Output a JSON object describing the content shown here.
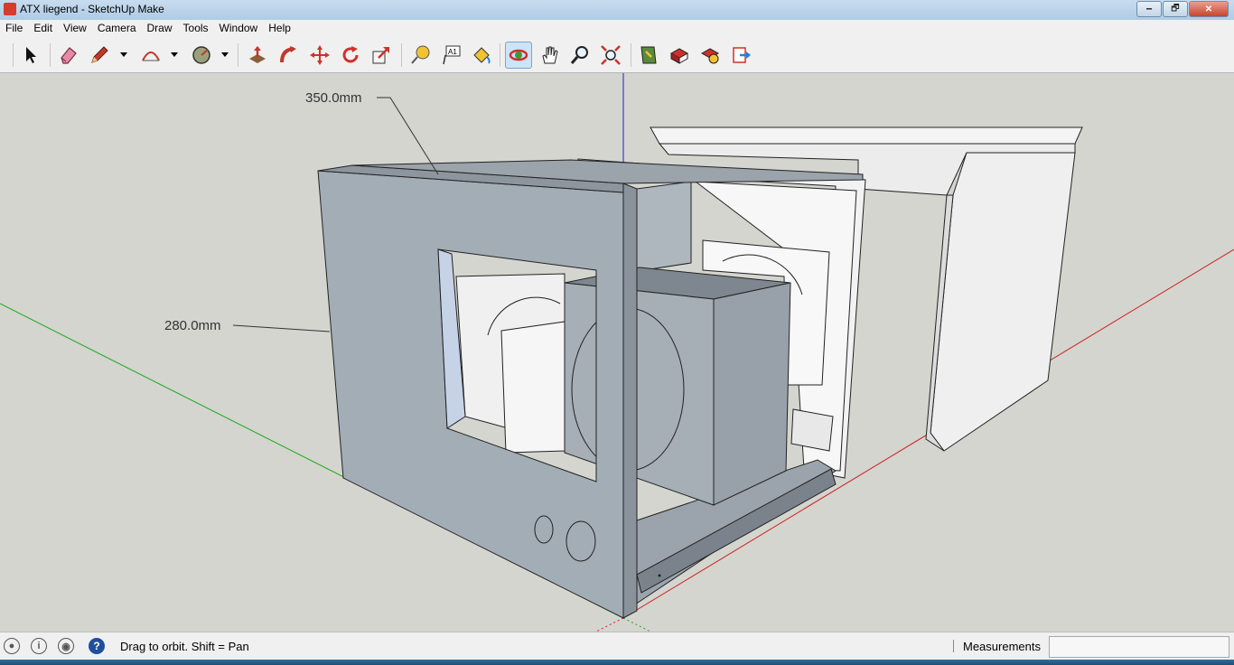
{
  "window": {
    "title": "ATX liegend - SketchUp Make",
    "minimize": "🗕",
    "maximize": "🗗",
    "close": "✕"
  },
  "menu": [
    "File",
    "Edit",
    "View",
    "Camera",
    "Draw",
    "Tools",
    "Window",
    "Help"
  ],
  "toolbar": {
    "tools": [
      {
        "name": "select-tool",
        "icon": "arrow-pointer-icon"
      },
      {
        "name": "eraser-tool",
        "icon": "eraser-icon"
      },
      {
        "name": "pencil-tool",
        "icon": "pencil-icon",
        "dropdown": true
      },
      {
        "name": "arc-tool",
        "icon": "arc-icon",
        "dropdown": true
      },
      {
        "name": "shape-tool",
        "icon": "circle-shape-icon",
        "dropdown": true
      },
      {
        "name": "push-pull-tool",
        "icon": "push-pull-icon"
      },
      {
        "name": "follow-me-tool",
        "icon": "follow-me-icon"
      },
      {
        "name": "move-tool",
        "icon": "move-icon"
      },
      {
        "name": "rotate-tool",
        "icon": "rotate-icon"
      },
      {
        "name": "scale-tool",
        "icon": "scale-icon"
      },
      {
        "name": "tape-measure-tool",
        "icon": "tape-measure-icon"
      },
      {
        "name": "text-tool",
        "icon": "text-icon"
      },
      {
        "name": "paint-bucket-tool",
        "icon": "paint-bucket-icon"
      },
      {
        "name": "orbit-tool",
        "icon": "orbit-icon",
        "active": true
      },
      {
        "name": "pan-tool",
        "icon": "hand-icon"
      },
      {
        "name": "zoom-tool",
        "icon": "magnifier-icon"
      },
      {
        "name": "zoom-extents-tool",
        "icon": "zoom-extents-icon"
      },
      {
        "name": "warehouse-tool",
        "icon": "warehouse-icon"
      },
      {
        "name": "share-model-tool",
        "icon": "share-model-icon"
      },
      {
        "name": "extension-warehouse-tool",
        "icon": "extension-warehouse-icon"
      },
      {
        "name": "layout-send-tool",
        "icon": "send-to-layout-icon"
      }
    ],
    "text_tool_label": "A1"
  },
  "viewport": {
    "dimensions": [
      "350.0mm",
      "280.0mm"
    ],
    "colors": {
      "background": "#d4d5cf",
      "case": "#a3adb6",
      "white_part": "#f0f0f0",
      "axis_red": "#cc2020",
      "axis_green": "#1aa81a",
      "axis_blue": "#2020cc"
    }
  },
  "status": {
    "hint": "Drag to orbit.  Shift = Pan",
    "measurements_label": "Measurements",
    "measurements_value": "",
    "help_glyph": "?",
    "info_glyph": "i"
  }
}
